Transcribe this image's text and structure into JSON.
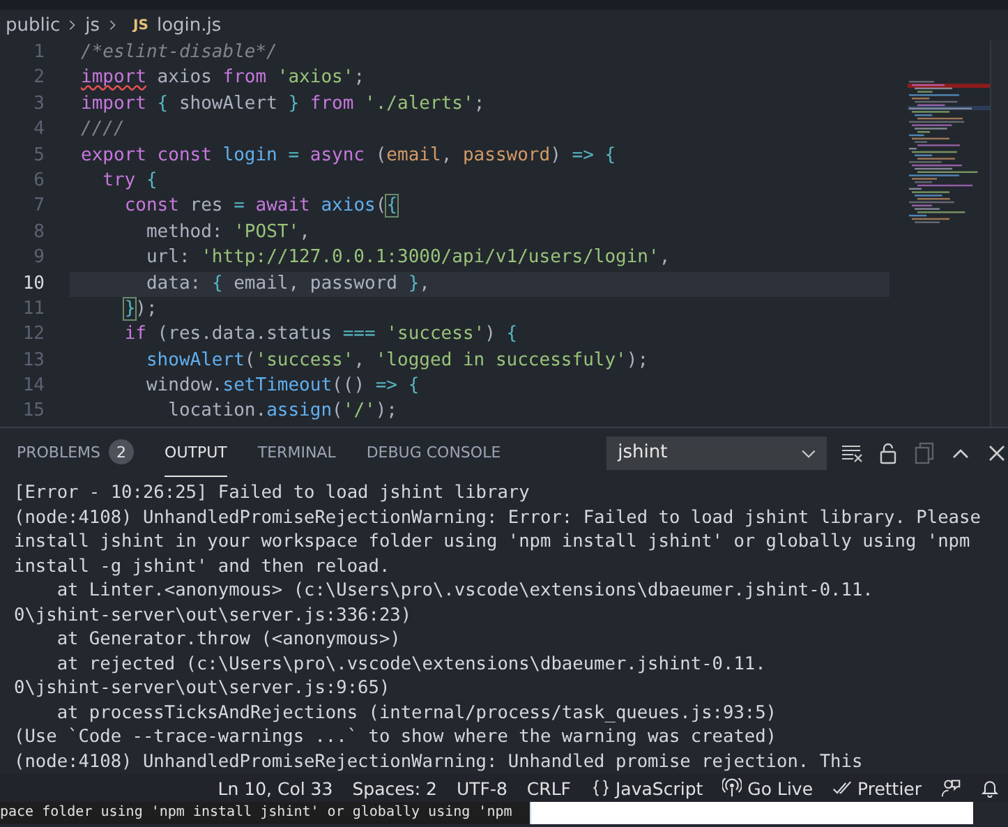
{
  "breadcrumb": [
    {
      "label": "public",
      "kind": "folder"
    },
    {
      "label": "js",
      "kind": "folder"
    },
    {
      "label": "login.js",
      "kind": "file",
      "icon_text": "JS"
    }
  ],
  "editor": {
    "lines": [
      {
        "number": "1",
        "current": false,
        "tokens": [
          {
            "t": "/*eslint-disable*/",
            "kind": "comment"
          }
        ]
      },
      {
        "number": "2",
        "current": false,
        "tokens": [
          {
            "t": "import",
            "kind": "keyword-error"
          },
          {
            "t": " axios ",
            "kind": "plain"
          },
          {
            "t": "from ",
            "kind": "keyword"
          },
          {
            "t": "'axios'",
            "kind": "string"
          },
          {
            "t": ";",
            "kind": "plain"
          }
        ]
      },
      {
        "number": "3",
        "current": false,
        "tokens": [
          {
            "t": "import ",
            "kind": "keyword"
          },
          {
            "t": "{",
            "kind": "punct"
          },
          {
            "t": " showAlert ",
            "kind": "plain"
          },
          {
            "t": "} ",
            "kind": "punct"
          },
          {
            "t": "from ",
            "kind": "keyword"
          },
          {
            "t": "'./alerts'",
            "kind": "string"
          },
          {
            "t": ";",
            "kind": "plain"
          }
        ]
      },
      {
        "number": "4",
        "current": false,
        "tokens": [
          {
            "t": "////",
            "kind": "comment"
          }
        ]
      },
      {
        "number": "5",
        "current": false,
        "tokens": [
          {
            "t": "export const ",
            "kind": "keyword"
          },
          {
            "t": "login ",
            "kind": "function"
          },
          {
            "t": "= ",
            "kind": "operator"
          },
          {
            "t": "async",
            "kind": "keyword"
          },
          {
            "t": " (",
            "kind": "plain"
          },
          {
            "t": "email",
            "kind": "param"
          },
          {
            "t": ", ",
            "kind": "plain"
          },
          {
            "t": "password",
            "kind": "param"
          },
          {
            "t": ") ",
            "kind": "plain"
          },
          {
            "t": "=> {",
            "kind": "operator"
          }
        ]
      },
      {
        "number": "6",
        "current": false,
        "tokens": [
          {
            "t": "  try ",
            "kind": "keyword"
          },
          {
            "t": "{",
            "kind": "punct"
          }
        ]
      },
      {
        "number": "7",
        "current": false,
        "tokens": [
          {
            "t": "    const",
            "kind": "keyword"
          },
          {
            "t": " res ",
            "kind": "plain"
          },
          {
            "t": "= ",
            "kind": "operator"
          },
          {
            "t": "await ",
            "kind": "keyword"
          },
          {
            "t": "axios",
            "kind": "function"
          },
          {
            "t": "(",
            "kind": "plain"
          },
          {
            "t": "{",
            "kind": "bracket-match"
          }
        ]
      },
      {
        "number": "8",
        "current": false,
        "tokens": [
          {
            "t": "      method: ",
            "kind": "plain"
          },
          {
            "t": "'POST'",
            "kind": "string"
          },
          {
            "t": ",",
            "kind": "plain"
          }
        ]
      },
      {
        "number": "9",
        "current": false,
        "tokens": [
          {
            "t": "      url: ",
            "kind": "plain"
          },
          {
            "t": "'http://127.0.0.1:3000/api/v1/users/login'",
            "kind": "string"
          },
          {
            "t": ",",
            "kind": "plain"
          }
        ]
      },
      {
        "number": "10",
        "current": true,
        "tokens": [
          {
            "t": "      data: ",
            "kind": "plain"
          },
          {
            "t": "{",
            "kind": "punct"
          },
          {
            "t": " email, password ",
            "kind": "plain"
          },
          {
            "t": "}",
            "kind": "punct"
          },
          {
            "t": ",",
            "kind": "plain"
          }
        ]
      },
      {
        "number": "11",
        "current": false,
        "tokens": [
          {
            "t": "    }",
            "kind": "bracket-match"
          },
          {
            "t": ");",
            "kind": "plain"
          }
        ]
      },
      {
        "number": "12",
        "current": false,
        "tokens": [
          {
            "t": "    if",
            "kind": "keyword"
          },
          {
            "t": " (res.data.status ",
            "kind": "plain"
          },
          {
            "t": "=== ",
            "kind": "operator"
          },
          {
            "t": "'success'",
            "kind": "string"
          },
          {
            "t": ") ",
            "kind": "plain"
          },
          {
            "t": "{",
            "kind": "punct"
          }
        ]
      },
      {
        "number": "13",
        "current": false,
        "tokens": [
          {
            "t": "      showAlert",
            "kind": "function"
          },
          {
            "t": "(",
            "kind": "plain"
          },
          {
            "t": "'success'",
            "kind": "string"
          },
          {
            "t": ", ",
            "kind": "plain"
          },
          {
            "t": "'logged in successfuly'",
            "kind": "string"
          },
          {
            "t": ");",
            "kind": "plain"
          }
        ]
      },
      {
        "number": "14",
        "current": false,
        "tokens": [
          {
            "t": "      window.",
            "kind": "plain"
          },
          {
            "t": "setTimeout",
            "kind": "function"
          },
          {
            "t": "(() ",
            "kind": "plain"
          },
          {
            "t": "=> {",
            "kind": "operator"
          }
        ]
      },
      {
        "number": "15",
        "current": false,
        "tokens": [
          {
            "t": "        location.",
            "kind": "plain"
          },
          {
            "t": "assign",
            "kind": "function"
          },
          {
            "t": "(",
            "kind": "plain"
          },
          {
            "t": "'/'",
            "kind": "string"
          },
          {
            "t": ");",
            "kind": "plain"
          }
        ]
      }
    ]
  },
  "panel": {
    "tabs": [
      {
        "label": "PROBLEMS",
        "badge": "2",
        "selected": false
      },
      {
        "label": "OUTPUT",
        "selected": true
      },
      {
        "label": "TERMINAL",
        "selected": false
      },
      {
        "label": "DEBUG CONSOLE",
        "selected": false
      }
    ],
    "channel": {
      "value": "jshint"
    },
    "actions": [
      {
        "kind": "clear",
        "disabled": false
      },
      {
        "kind": "lock",
        "disabled": false
      },
      {
        "kind": "copy",
        "disabled": true
      },
      {
        "kind": "maximize",
        "disabled": false
      },
      {
        "kind": "close",
        "disabled": false
      }
    ],
    "output": [
      "[Error - 10:26:25] Failed to load jshint library",
      "(node:4108) UnhandledPromiseRejectionWarning: Error: Failed to load jshint library. Please",
      "install jshint in your workspace folder using 'npm install jshint' or globally using 'npm",
      "install -g jshint' and then reload.",
      "    at Linter.<anonymous> (c:\\Users\\pro\\.vscode\\extensions\\dbaeumer.jshint-0.11.",
      "0\\jshint-server\\out\\server.js:336:23)",
      "    at Generator.throw (<anonymous>)",
      "    at rejected (c:\\Users\\pro\\.vscode\\extensions\\dbaeumer.jshint-0.11.",
      "0\\jshint-server\\out\\server.js:9:65)",
      "    at processTicksAndRejections (internal/process/task_queues.js:93:5)",
      "(Use `Code --trace-warnings ...` to show where the warning was created)",
      "(node:4108) UnhandledPromiseRejectionWarning: Unhandled promise rejection. This"
    ]
  },
  "status_bar": [
    {
      "label": "Ln 10, Col 33",
      "kind": "text"
    },
    {
      "label": "Spaces: 2",
      "kind": "text"
    },
    {
      "label": "UTF-8",
      "kind": "text"
    },
    {
      "label": "CRLF",
      "kind": "text"
    },
    {
      "label": "JavaScript",
      "kind": "language"
    },
    {
      "label": "Go Live",
      "kind": "live"
    },
    {
      "label": "Prettier",
      "kind": "formatter"
    },
    {
      "kind": "feedback"
    },
    {
      "kind": "notifications"
    }
  ],
  "background_window": {
    "text": "pace folder using 'npm install jshint' or globally using 'npm"
  }
}
